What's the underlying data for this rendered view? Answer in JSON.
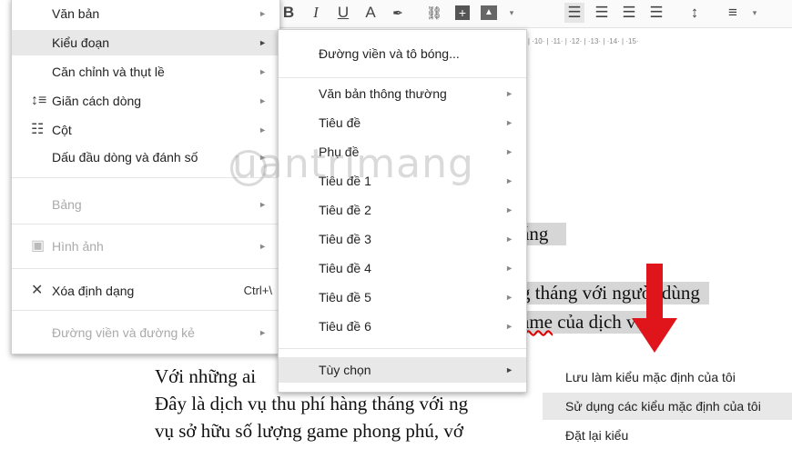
{
  "toolbar": {
    "bold": "B",
    "italic": "I",
    "underline": "U",
    "text_color": "A",
    "highlight": "✒",
    "link": "⛓",
    "comment": "+",
    "image": "▲"
  },
  "ruler": {
    "text": "· | ·10· | ·11· | ·12· | ·13· | ·14· | ·15·"
  },
  "left_menu": {
    "items": [
      {
        "label": "Văn bản",
        "disabled": false
      },
      {
        "label": "Kiểu đoạn",
        "disabled": false
      },
      {
        "label": "Căn chỉnh và thụt lề",
        "disabled": false
      },
      {
        "label": "Giãn cách dòng",
        "icon": "line-spacing-icon",
        "disabled": false
      },
      {
        "label": "Cột",
        "icon": "columns-icon",
        "disabled": false
      },
      {
        "label": "Dấu đầu dòng và đánh số",
        "disabled": false
      },
      {
        "label": "Bảng",
        "disabled": true
      },
      {
        "label": "Hình ảnh",
        "icon": "image-icon",
        "disabled": true
      },
      {
        "label": "Xóa định dạng",
        "icon": "clear-format-icon",
        "shortcut": "Ctrl+\\",
        "disabled": false
      },
      {
        "label": "Đường viền và đường kẻ",
        "disabled": true
      }
    ]
  },
  "style_menu": {
    "items": [
      {
        "label": "Đường viền và tô bóng..."
      },
      {
        "label": "Văn bản thông thường"
      },
      {
        "label": "Tiêu đề"
      },
      {
        "label": "Phụ đề"
      },
      {
        "label": "Tiêu đề 1"
      },
      {
        "label": "Tiêu đề 2"
      },
      {
        "label": "Tiêu đề 3"
      },
      {
        "label": "Tiêu đề 4"
      },
      {
        "label": "Tiêu đề 5"
      },
      {
        "label": "Tiêu đề 6"
      },
      {
        "label": "Tùy chọn"
      }
    ]
  },
  "options_menu": {
    "items": [
      {
        "label": "Lưu làm kiểu mặc định của tôi"
      },
      {
        "label": "Sử dụng các kiểu mặc định của tôi"
      },
      {
        "label": "Đặt lại kiểu"
      }
    ]
  },
  "document": {
    "line1": "áng",
    "line2": "g tháng với người dùng",
    "line3a": "ame",
    "line3b": " của dịch vụ.",
    "line4": "Với những ai",
    "line5": "Đây là dịch vụ thu phí hàng tháng với ng",
    "line6": "vụ sở hữu số lượng game phong phú, vớ"
  },
  "watermark": "uantrimang",
  "colors": {
    "arrow": "#e0141b",
    "highlight": "#d6d6d6"
  }
}
